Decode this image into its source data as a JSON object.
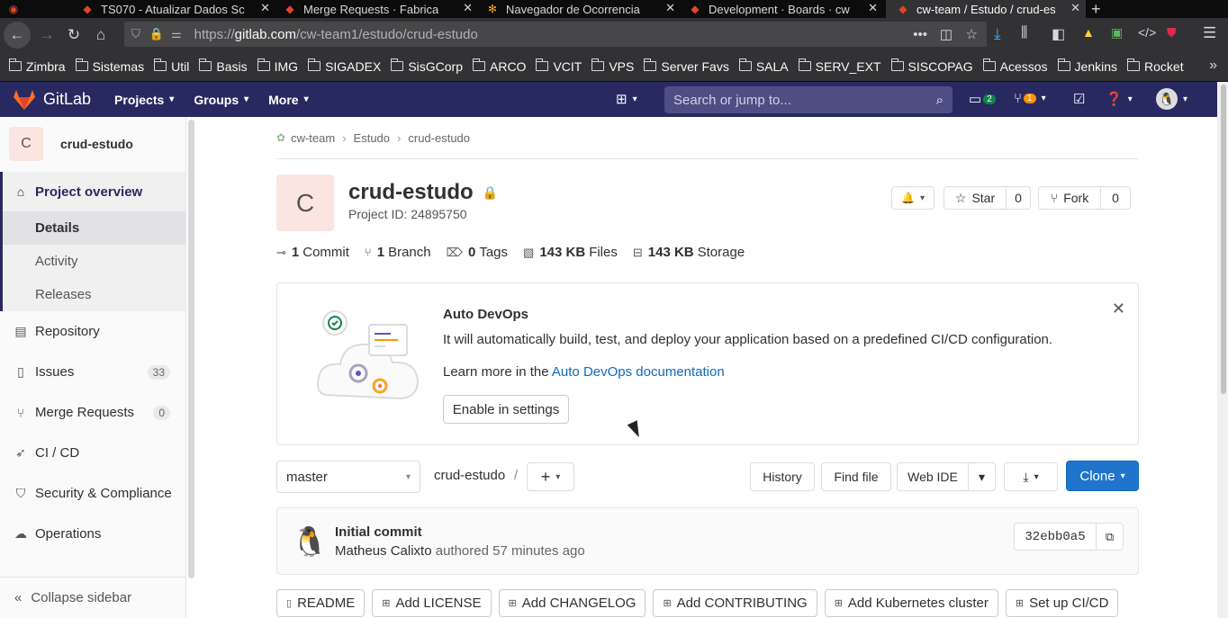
{
  "browser": {
    "tabs": [
      {
        "title": "TS070 - Atualizar Dados Sc"
      },
      {
        "title": "Merge Requests · Fabrica"
      },
      {
        "title": "Navegador de Ocorrencia"
      },
      {
        "title": "Development · Boards · cw"
      },
      {
        "title": "cw-team / Estudo / crud-es"
      }
    ],
    "url_scheme": "https://",
    "url_host": "gitlab.com",
    "url_path": "/cw-team1/estudo/crud-estudo",
    "bookmarks": [
      "Zimbra",
      "Sistemas",
      "Util",
      "Basis",
      "IMG",
      "SIGADEX",
      "SisGCorp",
      "ARCO",
      "VCIT",
      "VPS",
      "Server Favs",
      "SALA",
      "SERV_EXT",
      "SISCOPAG",
      "Acessos",
      "Jenkins",
      "Rocket"
    ]
  },
  "header": {
    "brand": "GitLab",
    "nav": [
      "Projects",
      "Groups",
      "More"
    ],
    "search_placeholder": "Search or jump to...",
    "issues_badge": "2",
    "mr_badge": "1"
  },
  "sidebar": {
    "project_initial": "C",
    "project_name": "crud-estudo",
    "overview": "Project overview",
    "sub": [
      "Details",
      "Activity",
      "Releases"
    ],
    "items": [
      {
        "label": "Repository"
      },
      {
        "label": "Issues",
        "count": "33"
      },
      {
        "label": "Merge Requests",
        "count": "0"
      },
      {
        "label": "CI / CD"
      },
      {
        "label": "Security & Compliance"
      },
      {
        "label": "Operations"
      }
    ],
    "collapse": "Collapse sidebar"
  },
  "breadcrumb": [
    "cw-team",
    "Estudo",
    "crud-estudo"
  ],
  "project": {
    "initial": "C",
    "title": "crud-estudo",
    "id_text": "Project ID: 24895750",
    "star_label": "Star",
    "star_count": "0",
    "fork_label": "Fork",
    "fork_count": "0"
  },
  "stats": [
    {
      "num": "1",
      "label": "Commit"
    },
    {
      "num": "1",
      "label": "Branch"
    },
    {
      "num": "0",
      "label": "Tags"
    },
    {
      "num": "143 KB",
      "label": "Files"
    },
    {
      "num": "143 KB",
      "label": "Storage"
    }
  ],
  "devops": {
    "title": "Auto DevOps",
    "text": "It will automatically build, test, and deploy your application based on a predefined CI/CD configuration.",
    "more_prefix": "Learn more in the ",
    "more_link": "Auto DevOps documentation",
    "button": "Enable in settings"
  },
  "repo": {
    "branch": "master",
    "path": "crud-estudo",
    "sep": "/",
    "history": "History",
    "find_file": "Find file",
    "web_ide": "Web IDE",
    "clone": "Clone"
  },
  "commit": {
    "message": "Initial commit",
    "author": "Matheus Calixto",
    "meta": "authored 57 minutes ago",
    "sha": "32ebb0a5"
  },
  "actions": [
    "README",
    "Add LICENSE",
    "Add CHANGELOG",
    "Add CONTRIBUTING",
    "Add Kubernetes cluster",
    "Set up CI/CD"
  ],
  "colors": {
    "header": "#292961",
    "link": "#1068bf",
    "clone": "#1f75cb"
  }
}
